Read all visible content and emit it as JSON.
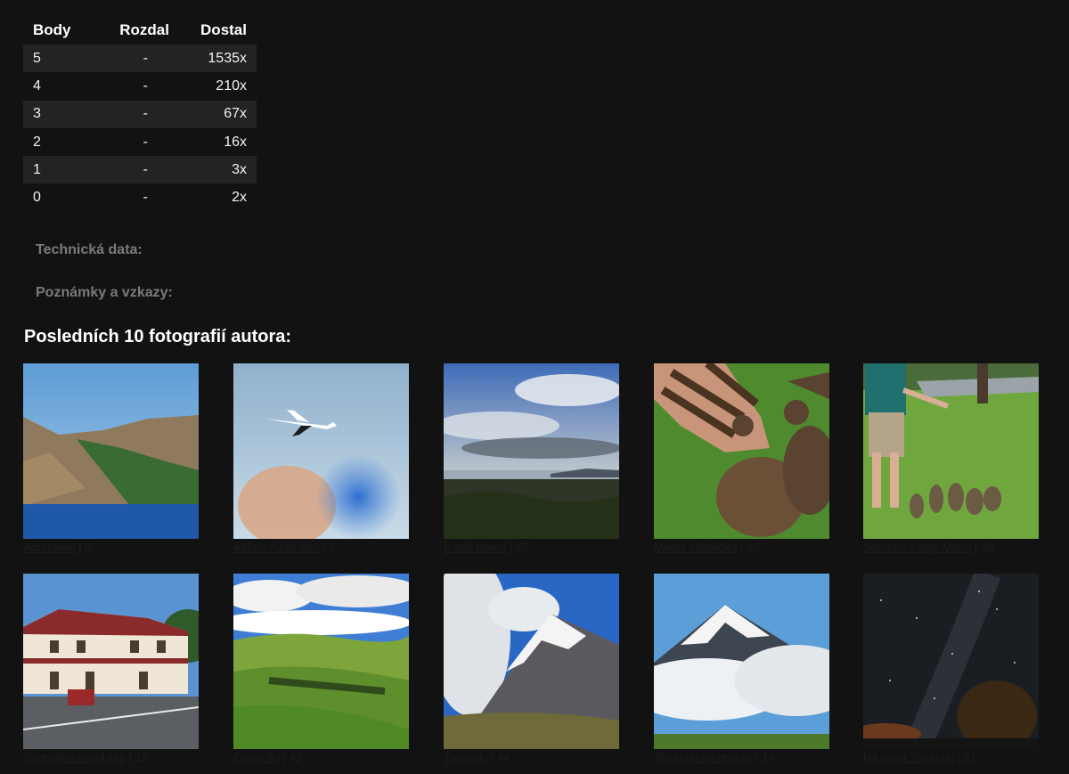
{
  "ratings": {
    "headers": {
      "body": "Body",
      "rozdal": "Rozdal",
      "dostal": "Dostal"
    },
    "rows": [
      {
        "body": "5",
        "rozdal": "-",
        "dostal": "1535x"
      },
      {
        "body": "4",
        "rozdal": "-",
        "dostal": "210x"
      },
      {
        "body": "3",
        "rozdal": "-",
        "dostal": "67x"
      },
      {
        "body": "2",
        "rozdal": "-",
        "dostal": "16x"
      },
      {
        "body": "1",
        "rozdal": "-",
        "dostal": "3x"
      },
      {
        "body": "0",
        "rozdal": "-",
        "dostal": "2x"
      }
    ]
  },
  "technical_label": "Technická data:",
  "notes_label": "Poznámky a vzkazy:",
  "gallery": {
    "title": "Posledních 10 fotografií autora:",
    "separator": " | ",
    "photos": [
      {
        "title": "Aorapawa",
        "score": "0"
      },
      {
        "title": "Airbus A320-200",
        "score": "5"
      },
      {
        "title": "Kapiti Island",
        "score": "27"
      },
      {
        "title": "Módní přehlídka",
        "score": "33"
      },
      {
        "title": "Somraci v Nga Manu",
        "score": "20"
      },
      {
        "title": "Svobodná republika",
        "score": "18"
      },
      {
        "title": "Cesta do",
        "score": "42"
      },
      {
        "title": "Tanaraki",
        "score": "44"
      },
      {
        "title": "Tanaraki na obzoru",
        "score": "14"
      },
      {
        "title": "Na úpatí Tanaraki",
        "score": "31"
      }
    ]
  },
  "colors": {
    "background": "#121212",
    "row_stripe": "#232323",
    "muted_label": "#7a7a7a",
    "caption_text": "#1d1d1d"
  }
}
